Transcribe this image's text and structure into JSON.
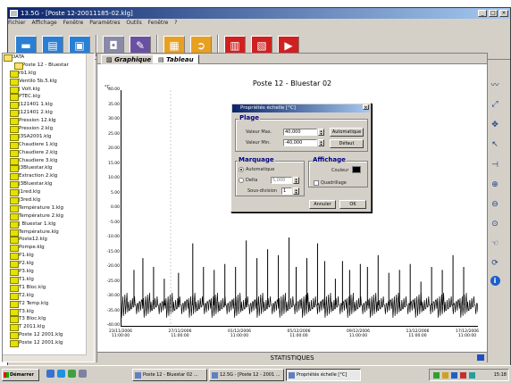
{
  "window": {
    "title": "13.5G - [Poste 12-20011185-02.klg]",
    "title_buttons": [
      "_",
      "□",
      "×"
    ]
  },
  "menubar": {
    "items": [
      "Fichier",
      "Affichage",
      "Fenêtre",
      "Paramètres",
      "Outils",
      "Fenêtre",
      "?"
    ]
  },
  "tree": {
    "root": "DATA",
    "sub": "Poste 12 - Bluestar",
    "items": [
      "rb1.klg",
      "Ventilo 5b.5.klg",
      "J Volt.klg",
      "PTEC.klg",
      "J121401 1.klg",
      "J121401 2.klg",
      "Pression 12.klg",
      "Pression 2.klg",
      "J3SA2001.klg",
      "Chaudiere 1.klg",
      "Chaudiere 2.klg",
      "Chaudiere 3.klg",
      "J3Bluestar.klg",
      "Extraction 2.klg",
      "J3Bluestar.klg",
      "J1red.klg",
      "J3red.klg",
      "Température 1.klg",
      "Température 2.klg",
      "J Bluestar 1.klg",
      "Température.klg",
      "Poste12.klg",
      "Pompe.klg",
      "P1.klg",
      "P2.klg",
      "P3.klg",
      "T1.klg",
      "T1 Bloc.klg",
      "T2.klg",
      "T2 Temp.klg",
      "T3.klg",
      "T3 Bloc.klg",
      "T 2011.klg",
      "Poste 12 2001.klg",
      "Poste 12 2001.klg"
    ]
  },
  "tabs": {
    "graph": "Graphique",
    "table": "Tableau"
  },
  "chart_data": {
    "type": "line",
    "title": "Poste 12 - Bluestar 02",
    "ylabel": "°C",
    "y_ticks": [
      "40.00",
      "35.00",
      "30.00",
      "25.00",
      "20.00",
      "15.00",
      "10.00",
      "5.00",
      "0.00",
      "-5.00",
      "-10.00",
      "-15.00",
      "-20.00",
      "-25.00",
      "-30.00",
      "-35.00",
      "-40.00"
    ],
    "ylim": [
      -40,
      40
    ],
    "x_ticks": [
      {
        "date": "23/11/2006",
        "time": "11:00:00"
      },
      {
        "date": "27/11/2006",
        "time": "11:00:00"
      },
      {
        "date": "01/12/2006",
        "time": "11:00:00"
      },
      {
        "date": "05/12/2006",
        "time": "11:00:00"
      },
      {
        "date": "09/12/2006",
        "time": "11:00:00"
      },
      {
        "date": "13/12/2006",
        "time": "11:00:00"
      },
      {
        "date": "17/12/2006",
        "time": "11:00:00"
      }
    ],
    "series": [
      {
        "color": "#000000",
        "baseline": -33,
        "spikes": [
          {
            "pos": 0.035,
            "value": -21
          },
          {
            "pos": 0.06,
            "value": -17
          },
          {
            "pos": 0.09,
            "value": -20
          },
          {
            "pos": 0.12,
            "value": -24
          },
          {
            "pos": 0.16,
            "value": -22
          },
          {
            "pos": 0.2,
            "value": -12
          },
          {
            "pos": 0.23,
            "value": -20
          },
          {
            "pos": 0.26,
            "value": -21
          },
          {
            "pos": 0.29,
            "value": -19
          },
          {
            "pos": 0.32,
            "value": -20
          },
          {
            "pos": 0.35,
            "value": -11
          },
          {
            "pos": 0.38,
            "value": -17
          },
          {
            "pos": 0.41,
            "value": -14
          },
          {
            "pos": 0.44,
            "value": -16
          },
          {
            "pos": 0.47,
            "value": -10
          },
          {
            "pos": 0.49,
            "value": -20
          },
          {
            "pos": 0.52,
            "value": -17
          },
          {
            "pos": 0.55,
            "value": -12
          },
          {
            "pos": 0.57,
            "value": -18
          },
          {
            "pos": 0.6,
            "value": -24
          },
          {
            "pos": 0.62,
            "value": -18
          },
          {
            "pos": 0.64,
            "value": -21
          },
          {
            "pos": 0.67,
            "value": -19
          },
          {
            "pos": 0.69,
            "value": -20
          },
          {
            "pos": 0.72,
            "value": -16
          },
          {
            "pos": 0.75,
            "value": -22
          },
          {
            "pos": 0.78,
            "value": -21
          },
          {
            "pos": 0.81,
            "value": -19
          },
          {
            "pos": 0.84,
            "value": -25
          },
          {
            "pos": 0.87,
            "value": -20
          },
          {
            "pos": 0.9,
            "value": -21
          },
          {
            "pos": 0.93,
            "value": -16
          },
          {
            "pos": 0.96,
            "value": -20
          }
        ]
      }
    ],
    "grid": false
  },
  "statistics_label": "STATISTIQUES",
  "dialog": {
    "title": "Propriétés échelle [°C]",
    "plage": {
      "title": "Plage",
      "max_label": "Valeur Max.",
      "max_value": "40,000",
      "min_label": "Valeur Min.",
      "min_value": "-40,000",
      "auto_button": "Automatique",
      "default_button": "Défaut"
    },
    "marquage": {
      "title": "Marquage",
      "auto_label": "Automatique",
      "custom_label": "Delta",
      "custom_value": "5,000",
      "subdiv_label": "Sous-division",
      "subdiv_value": "1"
    },
    "affichage": {
      "title": "Affichage",
      "color_label": "Couleur",
      "color": "#000000",
      "grid_label": "Quadrillage"
    },
    "cancel_button": "Annuler",
    "ok_button": "OK"
  },
  "toolbar": {
    "buttons": [
      {
        "name": "open-folder",
        "color": "#2a7fd4"
      },
      {
        "name": "open-file",
        "color": "#2a7fd4"
      },
      {
        "name": "save",
        "color": "#2a7fd4"
      },
      {
        "name": "image",
        "color": "#7a7a9a"
      },
      {
        "name": "edit",
        "color": "#6a50a0"
      },
      {
        "name": "report",
        "color": "#e8a020"
      },
      {
        "name": "export",
        "color": "#e8a020"
      },
      {
        "name": "device-read",
        "color": "#d02020"
      },
      {
        "name": "device-config",
        "color": "#d02020"
      },
      {
        "name": "device-start",
        "color": "#d02020"
      }
    ]
  },
  "right_tools": [
    "zoom-curve",
    "auto-scale",
    "move",
    "cursor",
    "marker",
    "zoom-in",
    "zoom-out",
    "zoom-reset",
    "hand",
    "refresh",
    "info"
  ],
  "taskbar": {
    "start": "Démarrer",
    "tasks": [
      "Poste 12 - Bluestar 02 ...",
      "12.5G - [Poste 12 - 2001 ...",
      "Propriétés échelle [°C]"
    ],
    "clock": "15:18"
  }
}
